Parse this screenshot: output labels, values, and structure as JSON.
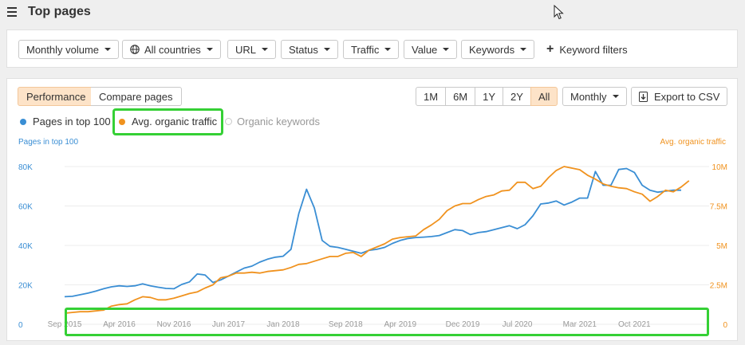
{
  "header": {
    "title": "Top pages"
  },
  "filters": {
    "monthly_volume": "Monthly volume",
    "all_countries": "All countries",
    "url": "URL",
    "status": "Status",
    "traffic": "Traffic",
    "value": "Value",
    "keywords": "Keywords",
    "keyword_filters": "Keyword filters"
  },
  "chart_toolbar": {
    "performance": "Performance",
    "compare_pages": "Compare pages",
    "ranges": [
      "1M",
      "6M",
      "1Y",
      "2Y",
      "All"
    ],
    "active_range": "All",
    "interval": "Monthly",
    "export": "Export to CSV"
  },
  "legend": {
    "pages_top100": "Pages in top 100",
    "avg_traffic": "Avg. organic traffic",
    "organic_keywords": "Organic keywords"
  },
  "colors": {
    "blue": "#3a8ed4",
    "orange": "#f0921e",
    "highlight": "#35d035",
    "accent_bg": "#fde3c8"
  },
  "chart_data": {
    "type": "line",
    "left_axis_title": "Pages in top 100",
    "right_axis_title": "Avg. organic traffic",
    "left_ticks": [
      "0",
      "20K",
      "40K",
      "60K",
      "80K"
    ],
    "left_ylim": [
      0,
      80000
    ],
    "right_ticks": [
      "0",
      "2.5M",
      "5M",
      "7.5M",
      "10M"
    ],
    "right_ylim": [
      0,
      10000000
    ],
    "x_tick_labels": [
      "Sep 2015",
      "Apr 2016",
      "Nov 2016",
      "Jun 2017",
      "Jan 2018",
      "Sep 2018",
      "Apr 2019",
      "Dec 2019",
      "Jul 2020",
      "Mar 2021",
      "Oct 2021"
    ],
    "x_tick_index": [
      0,
      7,
      14,
      21,
      28,
      36,
      43,
      51,
      58,
      66,
      73
    ],
    "x_start": "Jul 2015",
    "x_step": "1 month",
    "series": [
      {
        "name": "Pages in top 100",
        "color": "#3a8ed4",
        "axis": "left",
        "values": [
          14000,
          14200,
          15000,
          15800,
          16800,
          18000,
          19000,
          19500,
          19200,
          19500,
          20500,
          19500,
          18800,
          18200,
          18000,
          20200,
          21500,
          25500,
          25000,
          21200,
          22500,
          24500,
          26500,
          28500,
          29500,
          31500,
          33000,
          34000,
          34500,
          38000,
          56000,
          68500,
          59000,
          42500,
          39500,
          39000,
          38000,
          37000,
          36000,
          37500,
          38000,
          39000,
          41000,
          42500,
          43500,
          44000,
          44200,
          44500,
          45000,
          46500,
          48000,
          47500,
          45500,
          46500,
          47000,
          48000,
          49000,
          50000,
          48500,
          50500,
          55000,
          61000,
          61500,
          62500,
          60500,
          62000,
          64000,
          64000,
          77500,
          70500,
          70500,
          78500,
          79000,
          77000,
          70500,
          68000,
          67000,
          67500,
          68000,
          68000
        ]
      },
      {
        "name": "Avg. organic traffic",
        "color": "#f0921e",
        "axis": "right",
        "values": [
          700000,
          750000,
          800000,
          800000,
          850000,
          900000,
          1150000,
          1250000,
          1300000,
          1550000,
          1750000,
          1700000,
          1550000,
          1550000,
          1650000,
          1800000,
          1950000,
          2050000,
          2300000,
          2500000,
          2950000,
          3050000,
          3250000,
          3250000,
          3300000,
          3250000,
          3350000,
          3400000,
          3450000,
          3600000,
          3800000,
          3850000,
          4000000,
          4150000,
          4300000,
          4300000,
          4500000,
          4550000,
          4300000,
          4700000,
          4900000,
          5100000,
          5400000,
          5500000,
          5550000,
          5600000,
          6000000,
          6300000,
          6650000,
          7200000,
          7500000,
          7650000,
          7650000,
          7900000,
          8100000,
          8200000,
          8450000,
          8500000,
          9000000,
          9000000,
          8600000,
          8750000,
          9300000,
          9750000,
          10000000,
          9900000,
          9800000,
          9450000,
          9200000,
          8900000,
          8750000,
          8650000,
          8600000,
          8400000,
          8250000,
          7800000,
          8100000,
          8500000,
          8400000,
          8700000,
          9100000
        ]
      }
    ],
    "grid": true,
    "legend_position": "top-left"
  }
}
